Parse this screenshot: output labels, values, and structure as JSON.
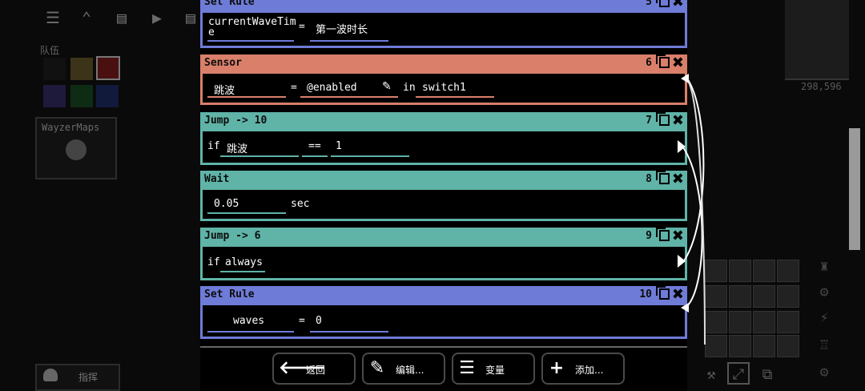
{
  "background": {
    "team_label": "队伍",
    "map_name": "WayzerMaps",
    "command_label": "指挥",
    "coords": "298,596",
    "team_colors": [
      "#111111",
      "#3c3418",
      "#4a1010",
      "#1e1a3c",
      "#0e2c14",
      "#121a3c"
    ],
    "top_tools": [
      "list-icon",
      "chevron-up-icon",
      "clipboard-icon",
      "play-icon",
      "clipboard-icon"
    ]
  },
  "instructions": [
    {
      "type": "Set Rule",
      "number": "5",
      "color": "#6e7bd7",
      "fields": [
        {
          "kind": "field",
          "text": "currentWaveTime"
        },
        {
          "kind": "text",
          "text": "="
        },
        {
          "kind": "field",
          "text": "第一波时长"
        }
      ]
    },
    {
      "type": "Sensor",
      "number": "6",
      "color": "#d97f6a",
      "fields": [
        {
          "kind": "field",
          "text": "跳波"
        },
        {
          "kind": "text",
          "text": "="
        },
        {
          "kind": "field",
          "text": "@enabled"
        },
        {
          "kind": "text",
          "text": "in"
        },
        {
          "kind": "field",
          "text": "switch1"
        }
      ]
    },
    {
      "type": "Jump -> 10",
      "number": "7",
      "color": "#5fb3a7",
      "fields": [
        {
          "kind": "text",
          "text": "if"
        },
        {
          "kind": "field",
          "text": "跳波"
        },
        {
          "kind": "field",
          "text": "=="
        },
        {
          "kind": "field",
          "text": "1"
        }
      ]
    },
    {
      "type": "Wait",
      "number": "8",
      "color": "#5fb3a7",
      "fields": [
        {
          "kind": "field",
          "text": "0.05"
        },
        {
          "kind": "text",
          "text": "sec"
        }
      ]
    },
    {
      "type": "Jump -> 6",
      "number": "9",
      "color": "#5fb3a7",
      "fields": [
        {
          "kind": "text",
          "text": "if"
        },
        {
          "kind": "field",
          "text": "always"
        }
      ]
    },
    {
      "type": "Set Rule",
      "number": "10",
      "color": "#6e7bd7",
      "fields": [
        {
          "kind": "field",
          "text": "waves"
        },
        {
          "kind": "text",
          "text": "="
        },
        {
          "kind": "field",
          "text": "0"
        }
      ]
    }
  ],
  "bottom_buttons": [
    {
      "label": "返回",
      "icon": "arrow-left-icon"
    },
    {
      "label": "编辑...",
      "icon": "edit-icon"
    },
    {
      "label": "变量",
      "icon": "list-icon"
    },
    {
      "label": "添加...",
      "icon": "plus-icon"
    }
  ]
}
